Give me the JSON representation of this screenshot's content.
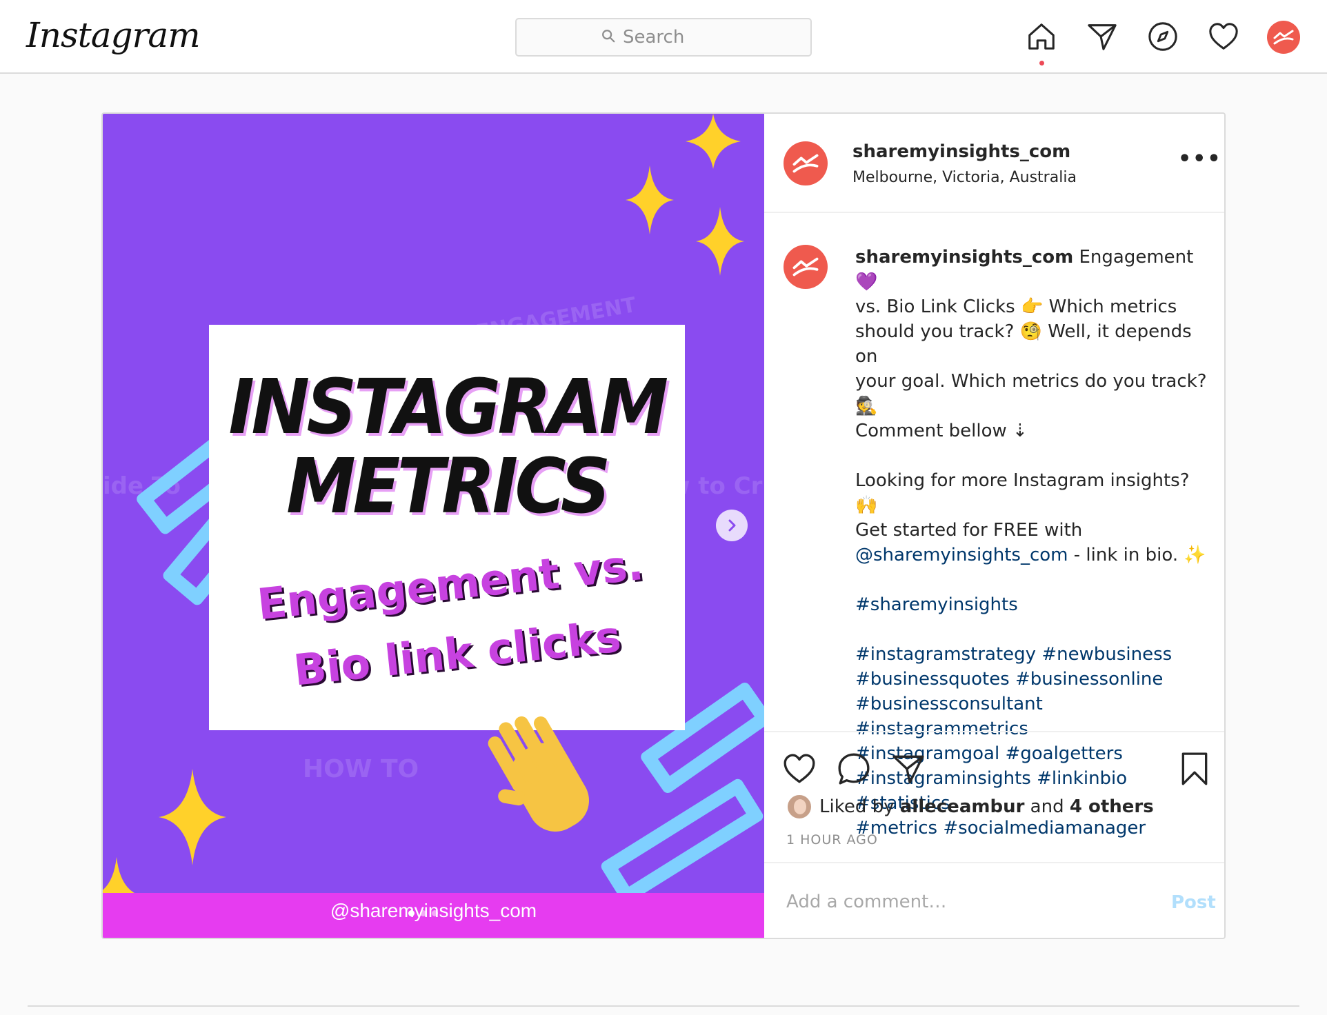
{
  "header": {
    "logo_text": "Instagram",
    "search_placeholder": "Search",
    "icons": [
      "home-icon",
      "direct-message-icon",
      "explore-icon",
      "activity-heart-icon",
      "profile-avatar"
    ]
  },
  "post": {
    "username": "sharemyinsights_com",
    "location": "Melbourne, Victoria, Australia",
    "more_label": "•••",
    "image": {
      "title_line1": "INSTAGRAM",
      "title_line2": "METRICS",
      "subtitle_line1": "Engagement vs.",
      "subtitle_line2": "Bio link clicks",
      "handle": "@sharemyinsights_com",
      "slide_count": 3,
      "active_slide": 1
    },
    "caption": {
      "username": "sharemyinsights_com",
      "body": " Engagement 💜\nvs. Bio Link Clicks 👉 Which metrics\nshould you track? 🧐 Well, it depends on\nyour goal. Which metrics do you track?\n🕵\nComment bellow ⇣\n\nLooking for more Instagram insights? 🙌\nGet started for FREE with\n",
      "mention": "@sharemyinsights_com",
      "after_mention": " - link in bio. ✨\n\n",
      "hashtag_main": "#sharemyinsights",
      "hashtags": "#instagramstrategy #newbusiness\n#businessquotes #businessonline\n#businessconsultant #instagrammetrics\n#instagramgoal #goalgetters\n#instagraminsights #linkinbio #statistics\n#metrics #socialmediamanager"
    },
    "likes": {
      "prefix": "Liked by ",
      "user": "alleceambur",
      "middle": " and ",
      "others": "4 others"
    },
    "time": "1 HOUR AGO",
    "comment_placeholder": "Add a comment…",
    "post_button": "Post"
  },
  "colors": {
    "accent": "#ef5a4e",
    "media_bg": "#8a4bf0",
    "pink_band": "#e63cf0",
    "link": "#00376b"
  }
}
